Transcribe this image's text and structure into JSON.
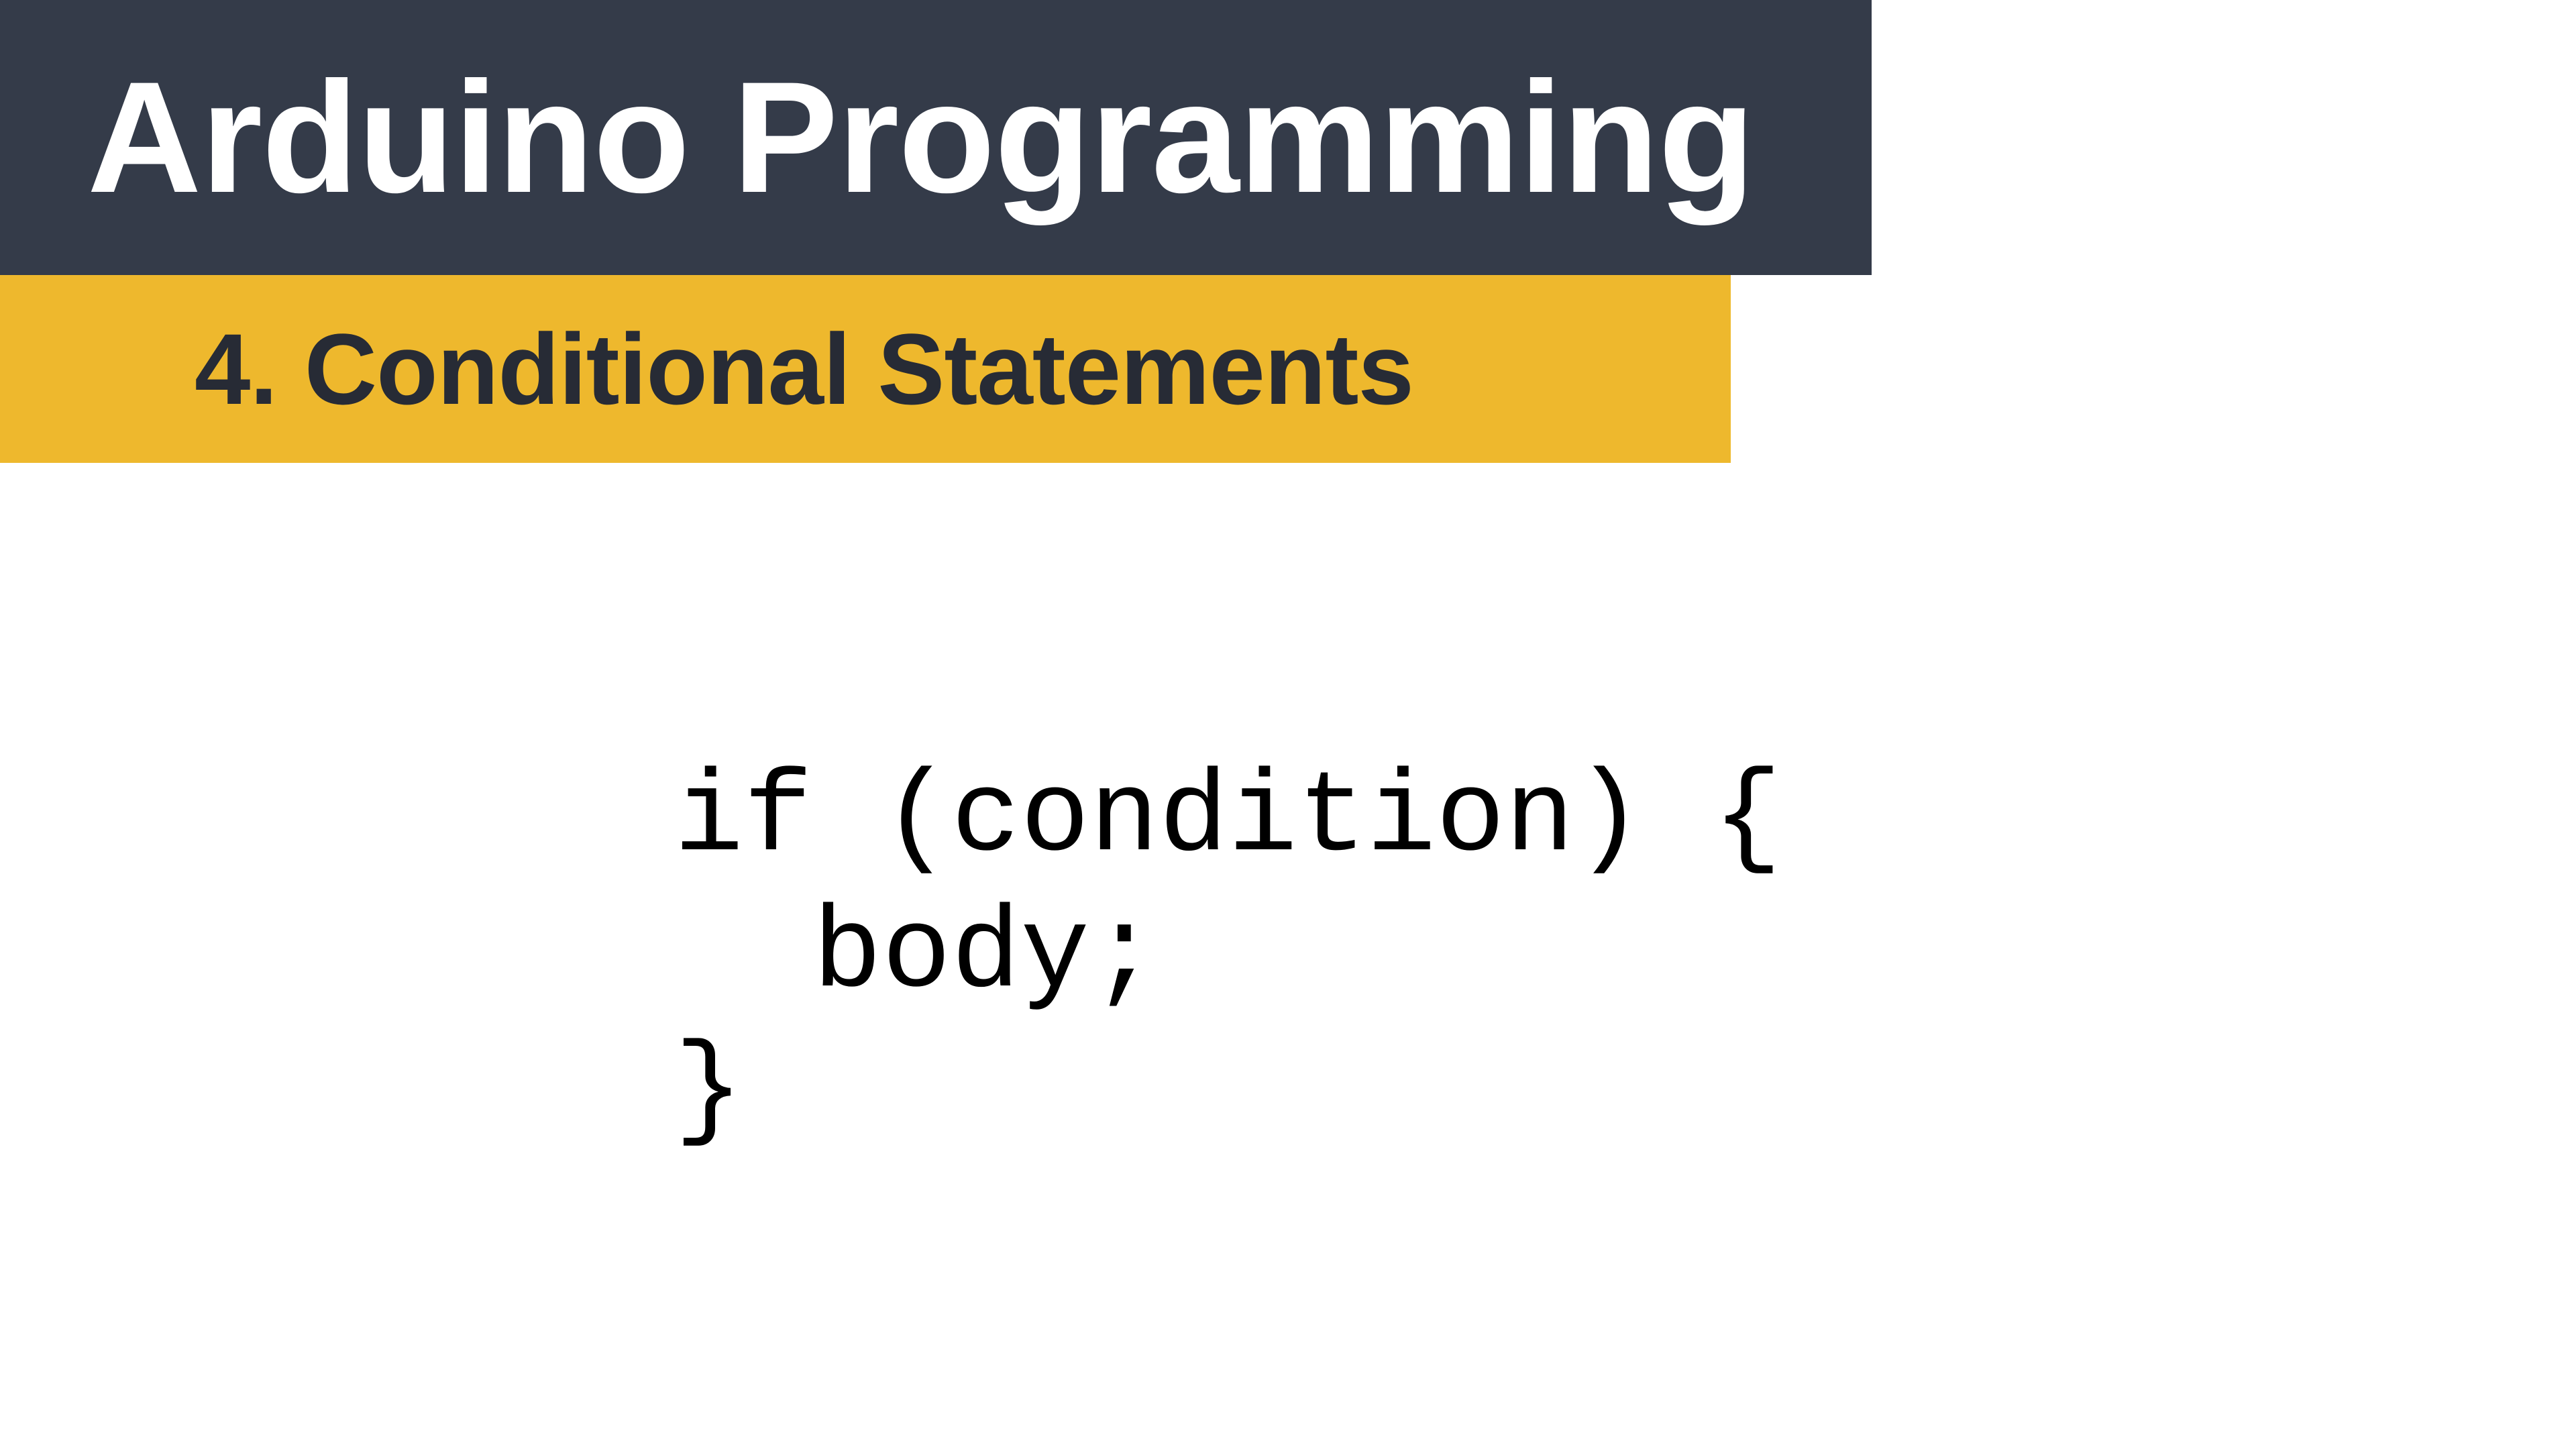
{
  "header": {
    "title": "Arduino Programming",
    "subtitle": "4.  Conditional Statements"
  },
  "code": {
    "line1": "if (condition) {",
    "line2": "  body;",
    "line3": "}"
  },
  "colors": {
    "titleBarBg": "#343b49",
    "titleText": "#ffffff",
    "subtitleBarBg": "#eeb82d",
    "subtitleText": "#272b35"
  }
}
